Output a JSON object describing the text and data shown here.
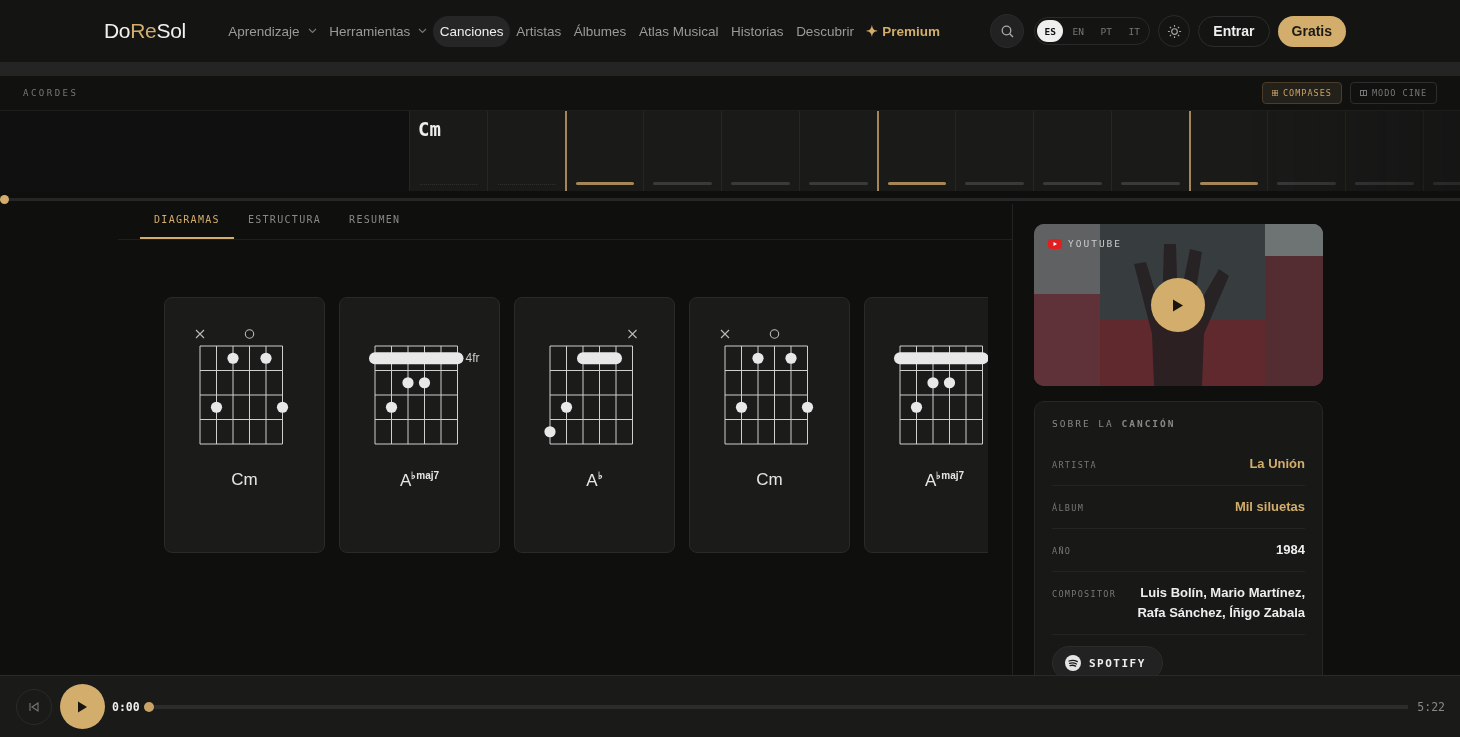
{
  "header": {
    "logo": {
      "start": "Do",
      "highlight": "Re",
      "end": "Sol"
    },
    "nav": [
      {
        "label": "Aprendizaje",
        "kind": "menu",
        "selected": false
      },
      {
        "label": "Herramientas",
        "kind": "menu",
        "selected": false
      },
      {
        "label": "Canciones",
        "kind": "link",
        "selected": true
      },
      {
        "label": "Artistas",
        "kind": "link",
        "selected": false
      },
      {
        "label": "Álbumes",
        "kind": "link",
        "selected": false
      },
      {
        "label": "Atlas Musical",
        "kind": "link",
        "selected": false
      },
      {
        "label": "Historias",
        "kind": "link",
        "selected": false
      },
      {
        "label": "Descubrir",
        "kind": "link",
        "selected": false
      },
      {
        "label": "✦ Premium",
        "kind": "premium",
        "selected": false
      }
    ],
    "languages": [
      {
        "label": "ES",
        "selected": true
      },
      {
        "label": "EN",
        "selected": false
      },
      {
        "label": "PT",
        "selected": false
      },
      {
        "label": "IT",
        "selected": false
      }
    ],
    "login": "Entrar",
    "signup": "Gratis"
  },
  "chords_bar": {
    "title": "ACORDES",
    "toggles": [
      {
        "label": "COMPASES",
        "kind": "grid",
        "selected": true
      },
      {
        "label": "MODO CINE",
        "kind": "cinema",
        "selected": false
      }
    ]
  },
  "timeline": {
    "measures": [
      {
        "chord": "Cm",
        "kind": "intro",
        "accent": false
      },
      {
        "kind": "intro",
        "accent": false
      },
      {
        "kind": "bar",
        "accent": true
      },
      {
        "kind": "bar",
        "accent": false
      },
      {
        "kind": "bar",
        "accent": false
      },
      {
        "kind": "bar",
        "accent": false
      },
      {
        "kind": "bar",
        "accent": true
      },
      {
        "kind": "bar",
        "accent": false
      },
      {
        "kind": "bar",
        "accent": false
      },
      {
        "kind": "bar",
        "accent": false
      },
      {
        "kind": "bar",
        "accent": true
      },
      {
        "kind": "bar",
        "accent": false
      },
      {
        "kind": "bar",
        "accent": false
      },
      {
        "kind": "bar",
        "accent": false
      }
    ],
    "level": 0
  },
  "tabs": [
    {
      "label": "DIAGRAMAS",
      "selected": true
    },
    {
      "label": "ESTRUCTURA",
      "selected": false
    },
    {
      "label": "RESUMEN",
      "selected": false
    }
  ],
  "chords": [
    {
      "name": "Cm",
      "kind": "cm"
    },
    {
      "name": "A$^{♭maj7}$",
      "kind": "abmaj7",
      "base_fret": "4fr"
    },
    {
      "name": "A$^{♭}$",
      "kind": "ab"
    },
    {
      "name": "Cm",
      "kind": "cm"
    },
    {
      "name": "A$^{♭maj7}$",
      "kind": "abmaj7"
    }
  ],
  "video": {
    "source": "YOUTUBE"
  },
  "about": {
    "title": "SOBRE LA **CANCIÓN**",
    "rows": [
      {
        "label": "ARTISTA",
        "value": "La Unión",
        "link": true
      },
      {
        "label": "ÁLBUM",
        "value": "Mil siluetas",
        "link": true
      },
      {
        "label": "AÑO",
        "value": "1984",
        "link": false
      },
      {
        "label": "COMPOSITOR",
        "value": "Luis Bolín, Mario Martínez, Rafa Sánchez, Íñigo Zabala",
        "link": false
      }
    ],
    "spotify": "SPOTIFY"
  },
  "player": {
    "current": "0:00",
    "duration": "5:22",
    "level": 0
  }
}
